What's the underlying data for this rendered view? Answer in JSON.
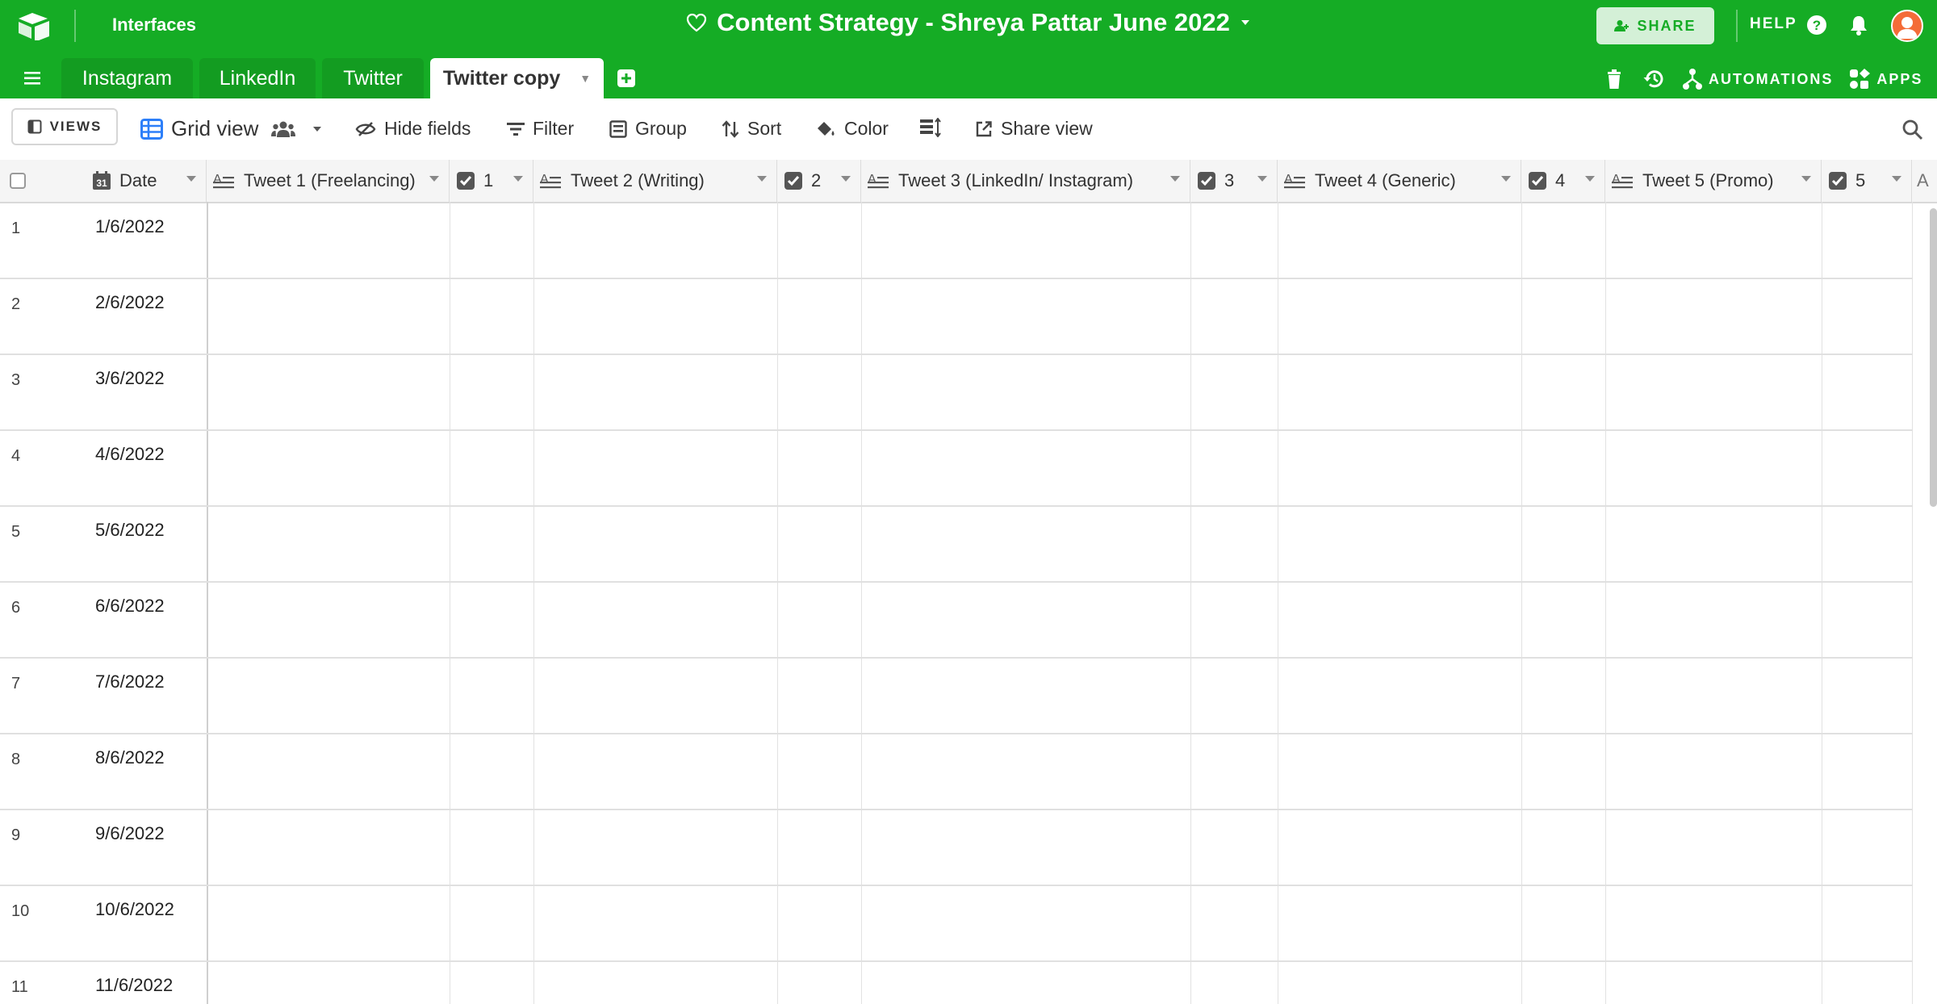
{
  "app": {
    "interfaces_label": "Interfaces",
    "base_title": "Content Strategy - Shreya Pattar June 2022",
    "share_label": "SHARE",
    "help_label": "HELP",
    "automations_label": "AUTOMATIONS",
    "apps_label": "APPS",
    "brand_color": "#15ac25",
    "avatar_color": "#f46c38"
  },
  "tabs": [
    {
      "label": "Instagram"
    },
    {
      "label": "LinkedIn"
    },
    {
      "label": "Twitter"
    },
    {
      "label": "Twitter copy",
      "active": true
    }
  ],
  "viewbar": {
    "views_label": "VIEWS",
    "grid_view_label": "Grid view",
    "hide_fields": "Hide fields",
    "filter": "Filter",
    "group": "Group",
    "sort": "Sort",
    "color": "Color",
    "share_view": "Share view"
  },
  "columns": [
    {
      "label": "Date",
      "type": "date"
    },
    {
      "label": "Tweet 1 (Freelancing)",
      "type": "long-text"
    },
    {
      "label": "1",
      "type": "checkbox"
    },
    {
      "label": "Tweet 2 (Writing)",
      "type": "long-text"
    },
    {
      "label": "2",
      "type": "checkbox"
    },
    {
      "label": "Tweet 3 (LinkedIn/ Instagram)",
      "type": "long-text"
    },
    {
      "label": "3",
      "type": "checkbox"
    },
    {
      "label": "Tweet 4 (Generic)",
      "type": "long-text"
    },
    {
      "label": "4",
      "type": "checkbox"
    },
    {
      "label": "Tweet 5 (Promo)",
      "type": "long-text"
    },
    {
      "label": "5",
      "type": "checkbox"
    }
  ],
  "rows": [
    {
      "num": "1",
      "date": "1/6/2022"
    },
    {
      "num": "2",
      "date": "2/6/2022"
    },
    {
      "num": "3",
      "date": "3/6/2022"
    },
    {
      "num": "4",
      "date": "4/6/2022"
    },
    {
      "num": "5",
      "date": "5/6/2022"
    },
    {
      "num": "6",
      "date": "6/6/2022"
    },
    {
      "num": "7",
      "date": "7/6/2022"
    },
    {
      "num": "8",
      "date": "8/6/2022"
    },
    {
      "num": "9",
      "date": "9/6/2022"
    },
    {
      "num": "10",
      "date": "10/6/2022"
    },
    {
      "num": "11",
      "date": "11/6/2022"
    }
  ]
}
